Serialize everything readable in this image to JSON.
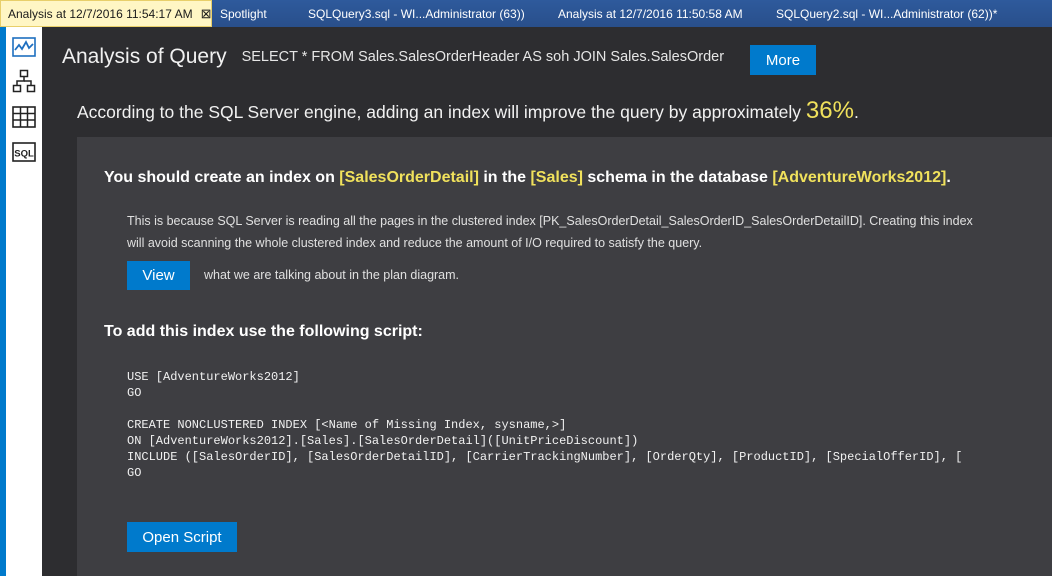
{
  "tabs": [
    {
      "label": "Analysis at 12/7/2016 11:54:17 AM",
      "close": "⊠",
      "active": true
    },
    {
      "label": "Spotlight"
    },
    {
      "label": "SQLQuery3.sql - WI...Administrator (63))"
    },
    {
      "label": "Analysis at 12/7/2016 11:50:58 AM"
    },
    {
      "label": "SQLQuery2.sql - WI...Administrator (62))*"
    }
  ],
  "toolbar": {
    "icons": [
      "activity-chart-icon",
      "hierarchy-icon",
      "table-grid-icon",
      "sql-icon"
    ],
    "sql_label": "SQL"
  },
  "header": {
    "title": "Analysis of Query",
    "query": "SELECT * FROM Sales.SalesOrderHeader AS soh JOIN Sales.SalesOrder",
    "more_label": "More"
  },
  "improvement": {
    "text": "According to the SQL Server engine, adding an index will improve the query by approximately ",
    "percent": "36%",
    "suffix": "."
  },
  "suggestion": {
    "prefix": "You should create an index on ",
    "table": "[SalesOrderDetail]",
    "middle": " in the ",
    "schema": "[Sales]",
    "middle2": " schema in the database ",
    "database": "[AdventureWorks2012]",
    "suffix": ".",
    "reason": "This is because SQL Server is reading all the pages in the clustered index [PK_SalesOrderDetail_SalesOrderID_SalesOrderDetailID]. Creating this index will avoid scanning the whole clustered index and reduce the amount of I/O required to satisfy the query.",
    "view_label": "View",
    "view_note": "what we are talking about in the plan diagram."
  },
  "script": {
    "heading": "To add this index use the following script:",
    "code": "USE [AdventureWorks2012]\nGO\n\nCREATE NONCLUSTERED INDEX [<Name of Missing Index, sysname,>]\nON [AdventureWorks2012].[Sales].[SalesOrderDetail]([UnitPriceDiscount])\nINCLUDE ([SalesOrderID], [SalesOrderDetailID], [CarrierTrackingNumber], [OrderQty], [ProductID], [SpecialOfferID], [\nGO",
    "open_label": "Open Script"
  },
  "colors": {
    "accent": "#007acc",
    "highlight": "#f0e15c",
    "background": "#2d2d30",
    "panel": "#3e3e42"
  }
}
